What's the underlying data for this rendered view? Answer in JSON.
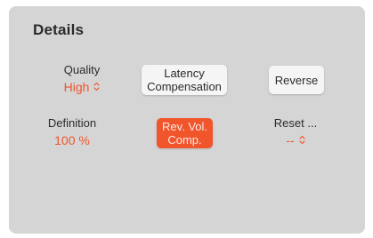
{
  "details": {
    "title": "Details",
    "quality": {
      "label": "Quality",
      "value": "High"
    },
    "definition": {
      "label": "Definition",
      "value": "100 %"
    },
    "latency_button_line1": "Latency",
    "latency_button_line2": "Compensation",
    "reverse_button": "Reverse",
    "rev_vol_button_line1": "Rev. Vol.",
    "rev_vol_button_line2": "Comp.",
    "reset": {
      "label": "Reset ...",
      "value": "--"
    }
  },
  "colors": {
    "panel_bg": "#d5d5d5",
    "accent": "#f0552c",
    "button_bg": "#f5f5f5"
  },
  "icons": {
    "stepper": "updown-chevron-icon"
  }
}
